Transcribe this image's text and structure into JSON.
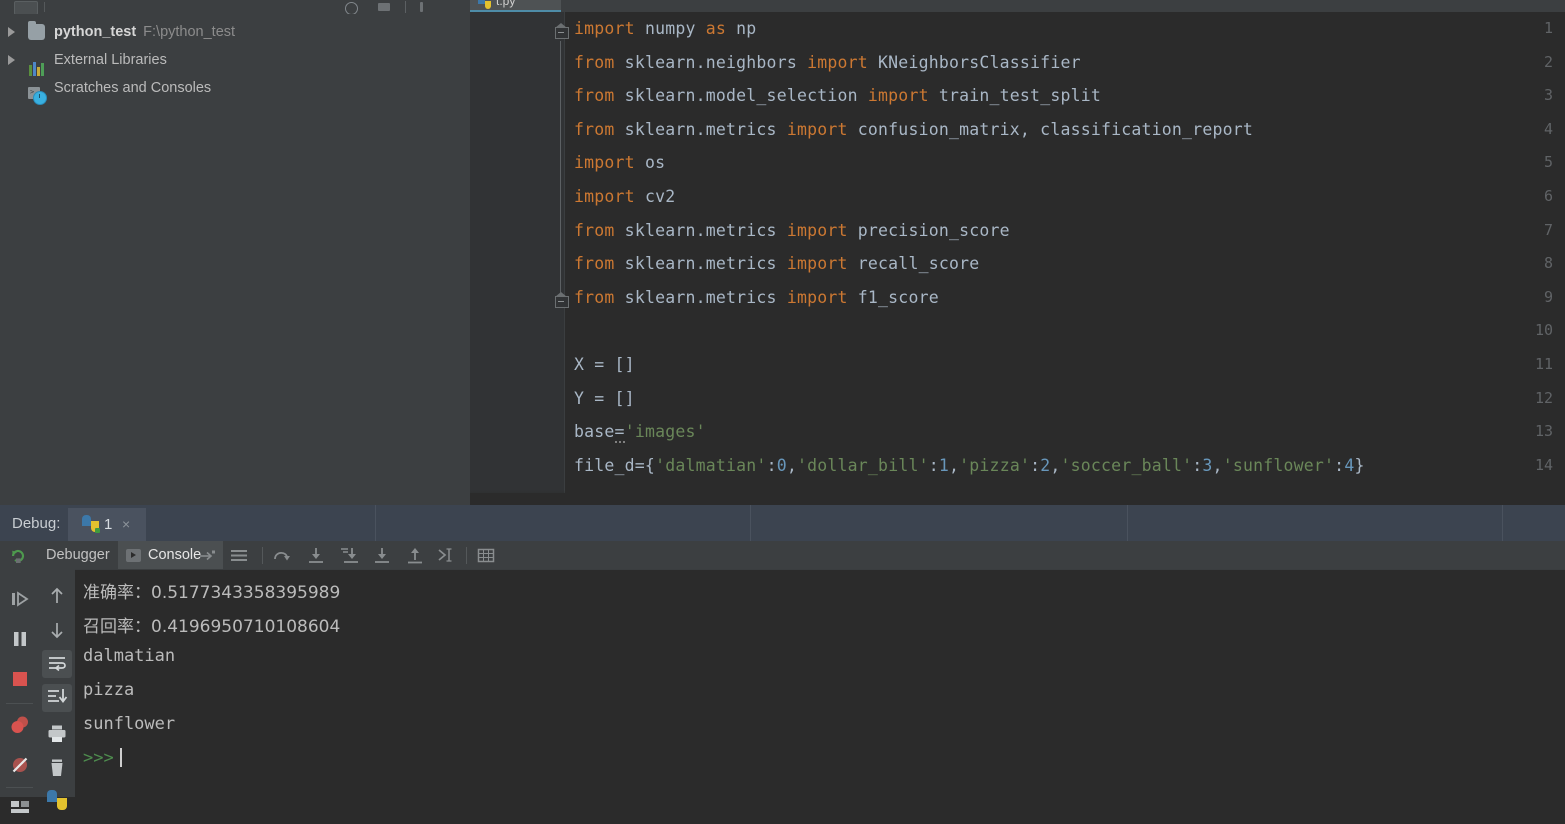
{
  "window": {
    "top_toolbar_icons": [
      "toolbar-button",
      "separator",
      "settings-circle-icon",
      "minimize-icon",
      "divider",
      "pin-icon"
    ]
  },
  "sidebar": {
    "name": "project-tool-window",
    "items": [
      {
        "label": "python_test",
        "path": "F:\\python_test",
        "icon": "folder-icon",
        "expandable": true,
        "bold": true
      },
      {
        "label": "External Libraries",
        "path": "",
        "icon": "libraries-icon",
        "expandable": true,
        "bold": false
      },
      {
        "label": "Scratches and Consoles",
        "path": "",
        "icon": "scratches-icon",
        "expandable": false,
        "bold": false
      }
    ]
  },
  "editor": {
    "tab": {
      "label": "t.py",
      "icon": "python-file-icon",
      "active": true
    },
    "gutter_first_line": 1,
    "lines": [
      {
        "n": 1,
        "tokens": [
          {
            "t": "import",
            "c": "kw"
          },
          {
            "t": " numpy ",
            "c": "pl"
          },
          {
            "t": "as",
            "c": "kw"
          },
          {
            "t": " np",
            "c": "pl"
          }
        ]
      },
      {
        "n": 2,
        "tokens": [
          {
            "t": "from",
            "c": "kw"
          },
          {
            "t": " sklearn.neighbors ",
            "c": "pl"
          },
          {
            "t": "import",
            "c": "kw"
          },
          {
            "t": " KNeighborsClassifier",
            "c": "pl"
          }
        ]
      },
      {
        "n": 3,
        "tokens": [
          {
            "t": "from",
            "c": "kw"
          },
          {
            "t": " sklearn.model_selection ",
            "c": "pl"
          },
          {
            "t": "import",
            "c": "kw"
          },
          {
            "t": " train_test_split",
            "c": "pl"
          }
        ]
      },
      {
        "n": 4,
        "tokens": [
          {
            "t": "from",
            "c": "kw"
          },
          {
            "t": " sklearn.metrics ",
            "c": "pl"
          },
          {
            "t": "import",
            "c": "kw"
          },
          {
            "t": " confusion_matrix, classification_report",
            "c": "pl"
          }
        ]
      },
      {
        "n": 5,
        "tokens": [
          {
            "t": "import",
            "c": "kw"
          },
          {
            "t": " os",
            "c": "pl"
          }
        ]
      },
      {
        "n": 6,
        "tokens": [
          {
            "t": "import",
            "c": "kw"
          },
          {
            "t": " cv2",
            "c": "pl"
          }
        ]
      },
      {
        "n": 7,
        "tokens": [
          {
            "t": "from",
            "c": "kw"
          },
          {
            "t": " sklearn.metrics ",
            "c": "pl"
          },
          {
            "t": "import",
            "c": "kw"
          },
          {
            "t": " precision_score",
            "c": "pl"
          }
        ]
      },
      {
        "n": 8,
        "tokens": [
          {
            "t": "from",
            "c": "kw"
          },
          {
            "t": " sklearn.metrics ",
            "c": "pl"
          },
          {
            "t": "import",
            "c": "kw"
          },
          {
            "t": " recall_score",
            "c": "pl"
          }
        ]
      },
      {
        "n": 9,
        "tokens": [
          {
            "t": "from",
            "c": "kw"
          },
          {
            "t": " sklearn.metrics ",
            "c": "pl"
          },
          {
            "t": "import",
            "c": "kw"
          },
          {
            "t": " f1_score",
            "c": "pl"
          }
        ]
      },
      {
        "n": 10,
        "tokens": []
      },
      {
        "n": 11,
        "tokens": [
          {
            "t": "X = []",
            "c": "pl"
          }
        ]
      },
      {
        "n": 12,
        "tokens": [
          {
            "t": "Y = []",
            "c": "pl"
          }
        ]
      },
      {
        "n": 13,
        "tokens": [
          {
            "t": "base",
            "c": "pl"
          },
          {
            "t": "=",
            "c": "warn"
          },
          {
            "t": "'images'",
            "c": "str"
          }
        ]
      },
      {
        "n": 14,
        "tokens": [
          {
            "t": "file_d={",
            "c": "pl"
          },
          {
            "t": "'dalmatian'",
            "c": "str"
          },
          {
            "t": ":",
            "c": "pl"
          },
          {
            "t": "0",
            "c": "num"
          },
          {
            "t": ",",
            "c": "pl"
          },
          {
            "t": "'dollar_bill'",
            "c": "str"
          },
          {
            "t": ":",
            "c": "pl"
          },
          {
            "t": "1",
            "c": "num"
          },
          {
            "t": ",",
            "c": "pl"
          },
          {
            "t": "'pizza'",
            "c": "str"
          },
          {
            "t": ":",
            "c": "pl"
          },
          {
            "t": "2",
            "c": "num"
          },
          {
            "t": ",",
            "c": "pl"
          },
          {
            "t": "'soccer_ball'",
            "c": "str"
          },
          {
            "t": ":",
            "c": "pl"
          },
          {
            "t": "3",
            "c": "num"
          },
          {
            "t": ",",
            "c": "pl"
          },
          {
            "t": "'sunflower'",
            "c": "str"
          },
          {
            "t": ":",
            "c": "pl"
          },
          {
            "t": "4",
            "c": "num"
          },
          {
            "t": "}",
            "c": "pl"
          }
        ]
      }
    ]
  },
  "debug": {
    "header_label": "Debug:",
    "session_tab": {
      "label": "1",
      "icon": "python-icon",
      "close": "×"
    },
    "toolbar": {
      "rerun_icon": "rerun-icon",
      "tabs": [
        {
          "label": "Debugger",
          "active": false,
          "icon": ""
        },
        {
          "label": "Console",
          "active": true,
          "icon": "console-run-icon"
        }
      ],
      "pin_icon": "pin-to-toolwindow-icon",
      "step_icons": [
        "show-execution-point-icon",
        "step-over-icon",
        "step-into-icon",
        "force-step-into-icon",
        "step-out-icon",
        "run-to-cursor-icon",
        "evaluate-expression-icon"
      ]
    },
    "rail_left_icons": [
      "resume-program-icon",
      "pause-program-icon",
      "stop-program-icon",
      "view-breakpoints-icon",
      "mute-breakpoints-icon",
      "layout-settings-icon"
    ],
    "rail_right_icons": [
      "scroll-up-icon",
      "scroll-down-icon",
      "soft-wrap-icon",
      "scroll-to-end-icon",
      "print-icon",
      "clear-all-icon",
      "python-console-icon"
    ]
  },
  "console": {
    "name": "debug-console-output",
    "lines": [
      {
        "text": "准确率：0.5177343358395989",
        "cjk": true,
        "style": "out"
      },
      {
        "text": "召回率：0.4196950710108604",
        "cjk": true,
        "style": "out"
      },
      {
        "text": "dalmatian",
        "cjk": false,
        "style": "out"
      },
      {
        "text": "pizza",
        "cjk": false,
        "style": "out"
      },
      {
        "text": "sunflower",
        "cjk": false,
        "style": "out"
      }
    ],
    "prompt": ">>>"
  },
  "colors": {
    "editor_bg": "#2b2b2b",
    "panel_bg": "#3c3f41",
    "gutter_bg": "#313335",
    "debug_header_bg": "#3c4450",
    "keyword": "#cc7832",
    "string": "#6a8759",
    "number": "#6897bb",
    "plain": "#a9b7c6",
    "prompt_green": "#4e8c4e",
    "tab_underline": "#4e8ca8"
  }
}
